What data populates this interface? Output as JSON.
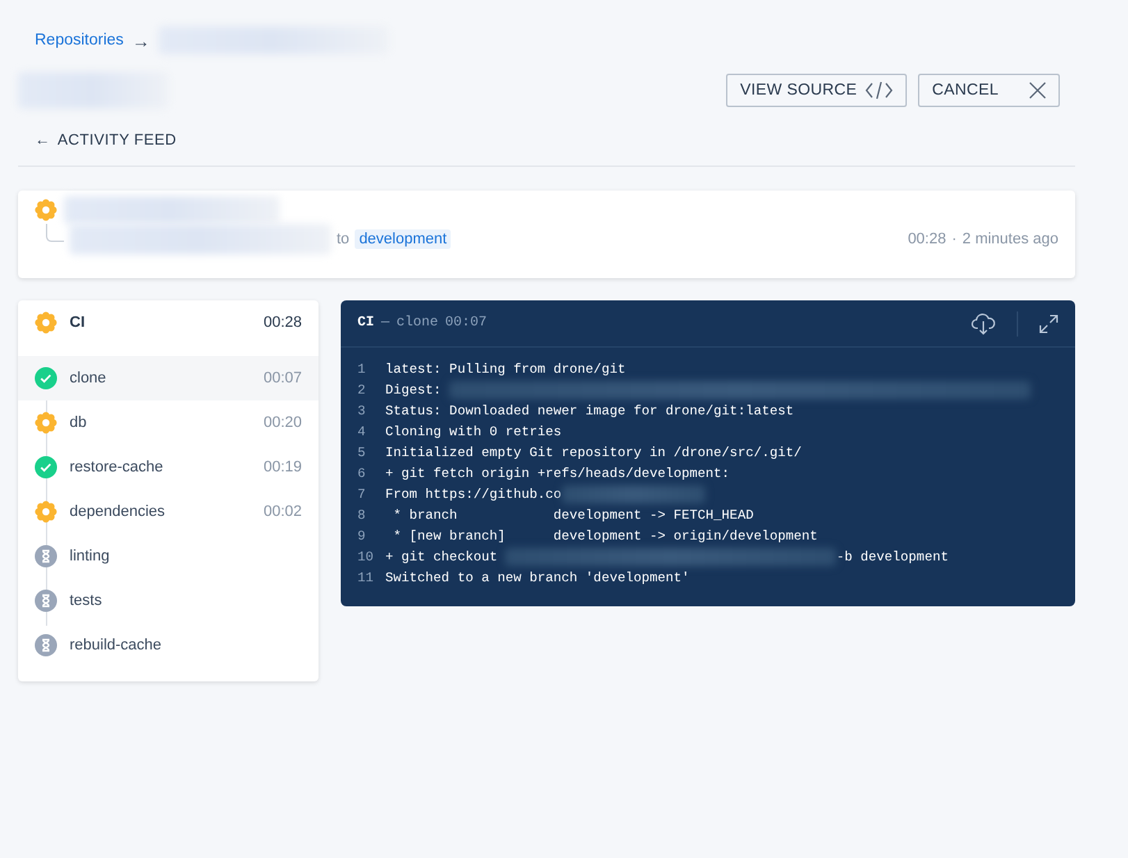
{
  "breadcrumb": {
    "link": "Repositories",
    "separator": "→"
  },
  "actions": [
    {
      "label": "VIEW SOURCE"
    },
    {
      "label": "CANCEL"
    }
  ],
  "back_link": {
    "arrow": "←",
    "label": "ACTIVITY FEED"
  },
  "build": {
    "kind": "running",
    "to": "to",
    "branch": "development",
    "duration": "00:28",
    "dot": "·",
    "ago": "2 minutes ago"
  },
  "pipeline": {
    "name": "CI",
    "kind": "running",
    "duration": "00:28"
  },
  "steps": [
    {
      "name": "clone",
      "kind": "success",
      "duration": "00:07",
      "selected": true
    },
    {
      "name": "db",
      "kind": "running",
      "duration": "00:20",
      "selected": false
    },
    {
      "name": "restore-cache",
      "kind": "success",
      "duration": "00:19",
      "selected": false
    },
    {
      "name": "dependencies",
      "kind": "running",
      "duration": "00:02",
      "selected": false
    },
    {
      "name": "linting",
      "kind": "pending",
      "selected": false
    },
    {
      "name": "tests",
      "kind": "pending",
      "selected": false
    },
    {
      "name": "rebuild-cache",
      "kind": "pending",
      "selected": false
    }
  ],
  "log": {
    "pipeline": "CI",
    "dash": "—",
    "step": "clone",
    "duration": "00:07",
    "lines": [
      {
        "num": "1",
        "kind": "plain",
        "text": "latest: Pulling from drone/git"
      },
      {
        "num": "2",
        "kind": "redacted",
        "text": "Digest: "
      },
      {
        "num": "3",
        "kind": "plain",
        "text": "Status: Downloaded newer image for drone/git:latest"
      },
      {
        "num": "4",
        "kind": "plain",
        "text": "Cloning with 0 retries"
      },
      {
        "num": "5",
        "kind": "plain",
        "text": "Initialized empty Git repository in /drone/src/.git/"
      },
      {
        "num": "6",
        "kind": "plain",
        "text": "+ git fetch origin +refs/heads/development:"
      },
      {
        "num": "7",
        "kind": "redacted",
        "text": "From https://github.co"
      },
      {
        "num": "8",
        "kind": "plain",
        "text": " * branch            development -> FETCH_HEAD"
      },
      {
        "num": "9",
        "kind": "plain",
        "text": " * [new branch]      development -> origin/development"
      },
      {
        "num": "10",
        "kind": "redacted",
        "text": "+ git checkout ",
        "tail": "-b development"
      },
      {
        "num": "11",
        "kind": "plain",
        "text": "Switched to a new branch 'development'"
      }
    ]
  }
}
